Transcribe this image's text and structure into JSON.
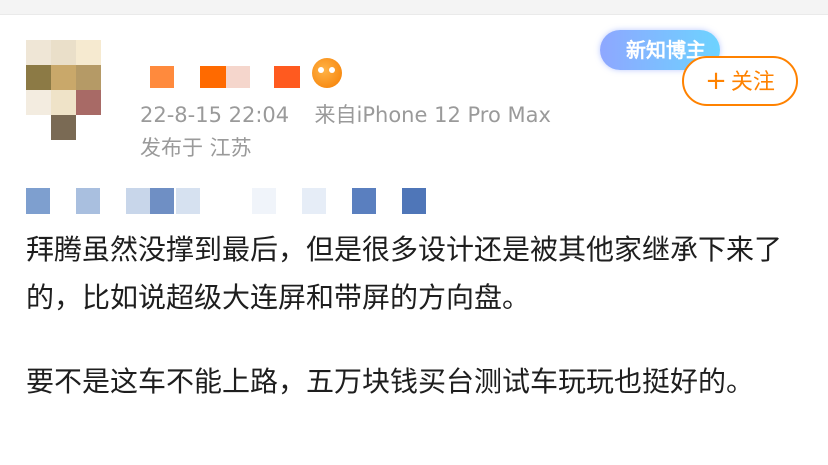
{
  "post_meta": {
    "date_time": "22-8-15 22:04",
    "source": "来自iPhone 12 Pro Max",
    "location": "发布于 江苏"
  },
  "badge": {
    "label": "新知博主"
  },
  "follow_button": {
    "label": "关注",
    "icon": "plus-icon"
  },
  "content": {
    "paragraphs": [
      "拜腾虽然没撑到最后，但是很多设计还是被其他家继承下来了的，比如说超级大连屏和带屏的方向盘。",
      "要不是这车不能上路，五万块钱买台测试车玩玩也挺好的。"
    ]
  },
  "colors": {
    "accent": "#ff8200",
    "meta_text": "#9a9a9a",
    "body_text": "#1e1e1e"
  }
}
